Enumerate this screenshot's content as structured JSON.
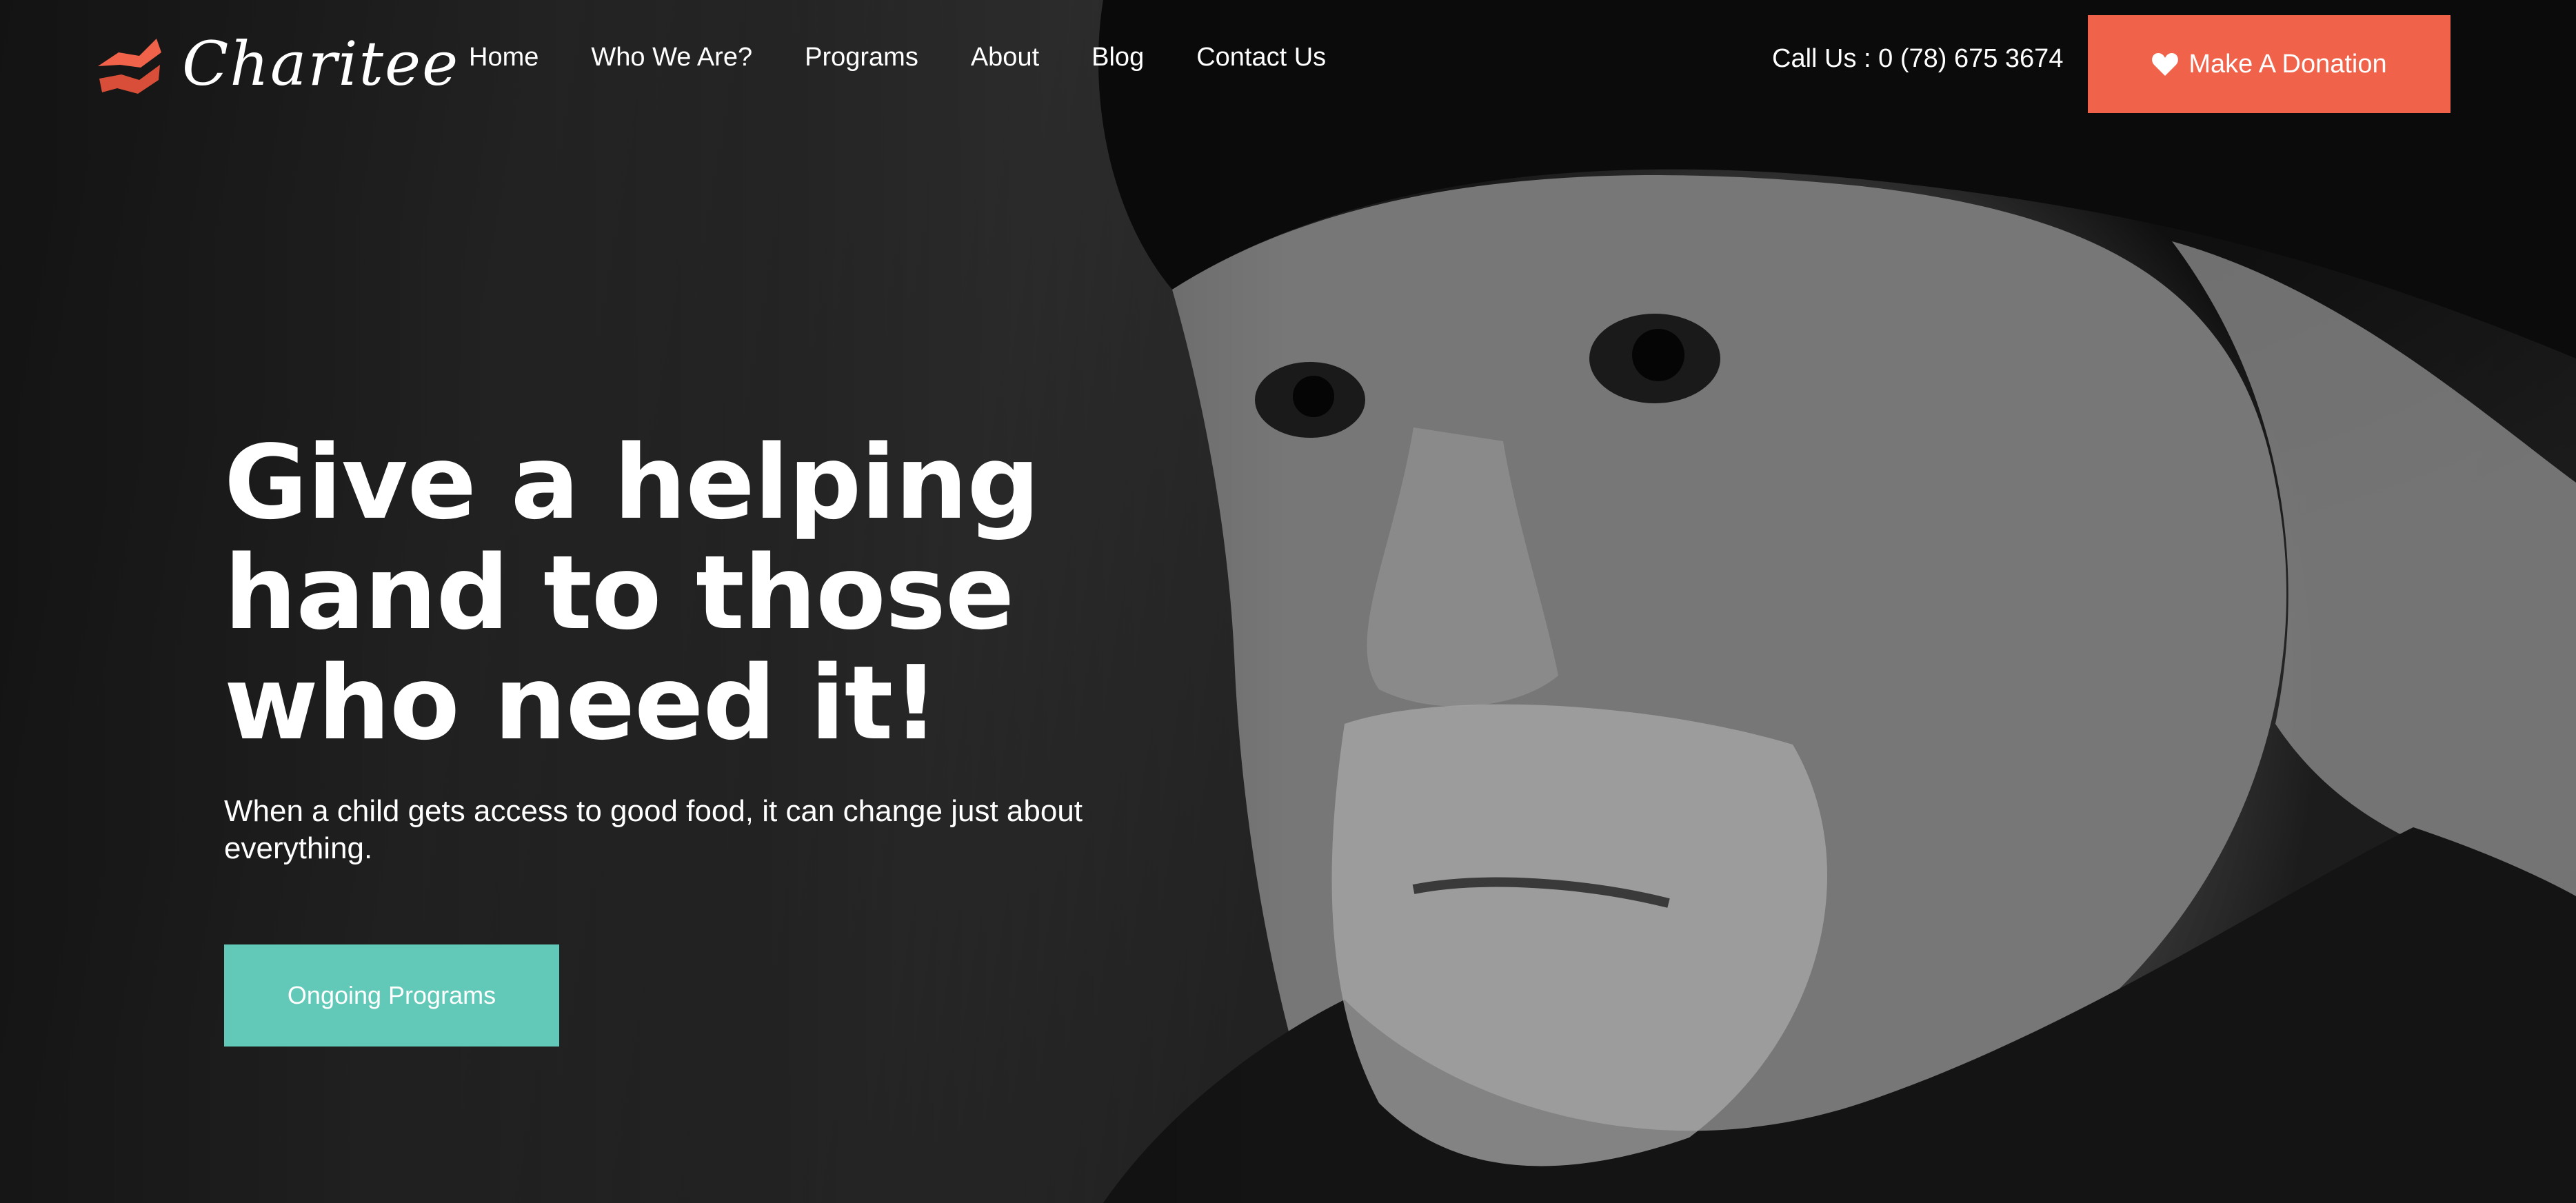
{
  "brand": {
    "name": "Charitee",
    "accent_color": "#f0624a"
  },
  "nav": {
    "items": [
      {
        "label": "Home"
      },
      {
        "label": "Who We Are?"
      },
      {
        "label": "Programs"
      },
      {
        "label": "About"
      },
      {
        "label": "Blog"
      },
      {
        "label": "Contact Us"
      }
    ]
  },
  "header": {
    "call_text": "Call Us : 0 (78) 675 3674",
    "donate_label": "Make A Donation",
    "donate_icon": "heart-icon",
    "donate_color": "#f0624a"
  },
  "hero": {
    "headline": "Give a helping hand to those who need it!",
    "subtext": "When a child gets access to good food, it can change just about everything.",
    "button_label": "Ongoing Programs",
    "button_color": "#62c9b8"
  }
}
